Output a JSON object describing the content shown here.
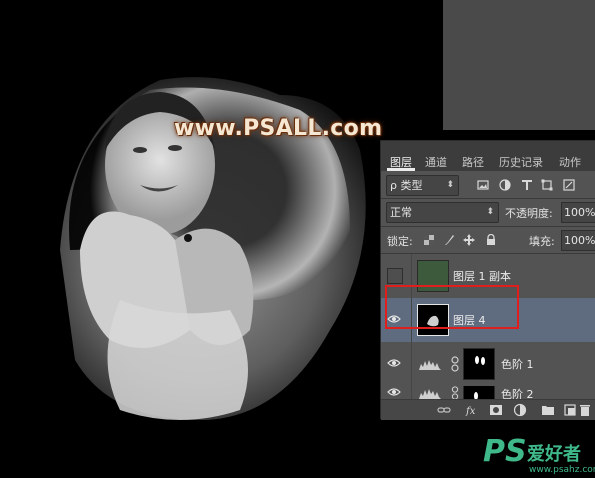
{
  "watermark": "www.PSALL.com",
  "panel": {
    "tabs": [
      {
        "label": "图层",
        "active": true
      },
      {
        "label": "通道"
      },
      {
        "label": "路径"
      },
      {
        "label": "历史记录"
      },
      {
        "label": "动作"
      }
    ],
    "filter_kind": "ρ 类型",
    "blend_mode": "正常",
    "opacity_label": "不透明度:",
    "opacity_value": "100%",
    "lock_label": "锁定:",
    "fill_label": "填充:",
    "fill_value": "100%",
    "layers": [
      {
        "name": "图层 1 副本",
        "visible": false,
        "selected": false,
        "thumb_color": "#3d5a3d"
      },
      {
        "name": "图层 4",
        "visible": true,
        "selected": true
      },
      {
        "name": "色阶 1",
        "visible": true,
        "selected": false
      },
      {
        "name": "色阶 2",
        "visible": true,
        "selected": false
      }
    ]
  },
  "logo": {
    "ps": "PS",
    "cn": "爱好者",
    "url": "www.psahz.com"
  },
  "colors": {
    "panel_bg": "#535353",
    "selected_row": "#5f6b7e",
    "highlight": "#e01e1e",
    "logo_green": "#3fb88a"
  }
}
